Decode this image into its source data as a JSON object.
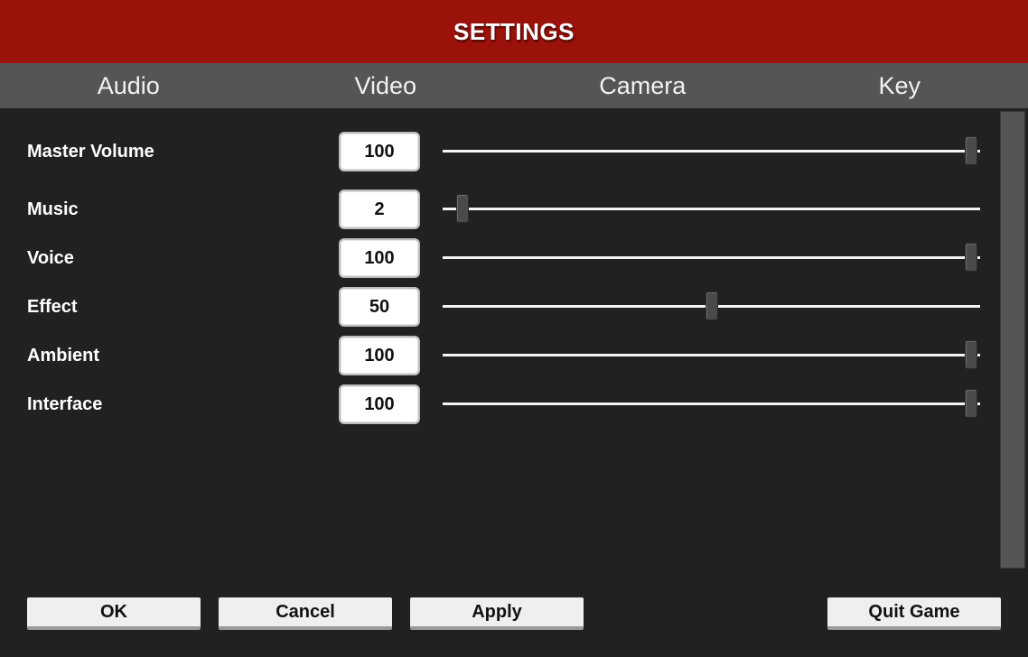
{
  "header": {
    "title": "SETTINGS"
  },
  "tabs": [
    {
      "label": "Audio"
    },
    {
      "label": "Video"
    },
    {
      "label": "Camera"
    },
    {
      "label": "Key"
    }
  ],
  "audio": {
    "sliders": [
      {
        "label": "Master Volume",
        "value": "100",
        "fraction": 1.0
      },
      {
        "label": "Music",
        "value": "2",
        "fraction": 0.02
      },
      {
        "label": "Voice",
        "value": "100",
        "fraction": 1.0
      },
      {
        "label": "Effect",
        "value": "50",
        "fraction": 0.5
      },
      {
        "label": "Ambient",
        "value": "100",
        "fraction": 1.0
      },
      {
        "label": "Interface",
        "value": "100",
        "fraction": 1.0
      }
    ]
  },
  "footer": {
    "ok_label": "OK",
    "cancel_label": "Cancel",
    "apply_label": "Apply",
    "quit_label": "Quit Game"
  },
  "colors": {
    "header_bg": "#9b120b",
    "tab_bar_bg": "#555555",
    "panel_bg": "#212121"
  }
}
